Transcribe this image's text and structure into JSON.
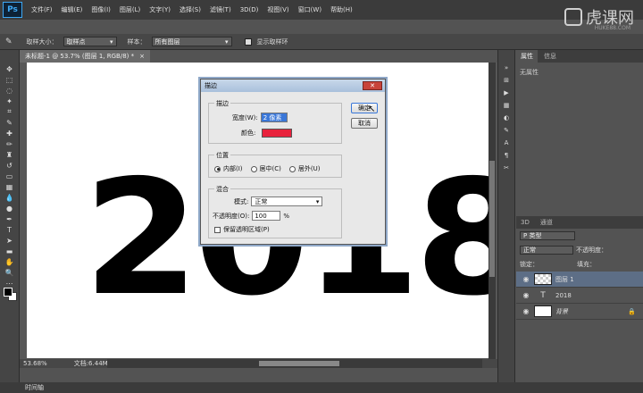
{
  "app": {
    "logo": "Ps"
  },
  "menu": [
    "文件(F)",
    "编辑(E)",
    "图像(I)",
    "图层(L)",
    "文字(Y)",
    "选择(S)",
    "滤镜(T)",
    "3D(D)",
    "视图(V)",
    "窗口(W)",
    "帮助(H)"
  ],
  "watermark": {
    "text": "虎课网",
    "url": "HUKE88.COM"
  },
  "options": {
    "sample_size_label": "取样大小：",
    "sample_size_value": "取样点",
    "sample_label": "样本：",
    "sample_value": "所有图层",
    "show_ring_label": "显示取样环"
  },
  "document": {
    "tab_title": "未标题-1 @ 53.7% (图层 1, RGB/8) *",
    "canvas_text": "2018"
  },
  "status": {
    "zoom": "53.68%",
    "doc_info": "文档:6.44M/1.88M"
  },
  "timeline": {
    "label": "时间轴"
  },
  "panels": {
    "tabs": [
      "属性",
      "信息"
    ],
    "props_text": "无属性",
    "layer_tabs": [
      "3D",
      "通道",
      "图层"
    ],
    "filter": "P 类型",
    "blend_mode": "正常",
    "opacity_label": "不透明度：",
    "lock_label": "锁定：",
    "fill_label": "填充：",
    "layers": [
      {
        "name": "图层 1",
        "type": "raster",
        "selected": true
      },
      {
        "name": "2018",
        "type": "text",
        "selected": false
      },
      {
        "name": "背景",
        "type": "background",
        "selected": false
      }
    ]
  },
  "dialog": {
    "title": "描边",
    "stroke_group": "描边",
    "width_label": "宽度(W):",
    "width_value": "2 像素",
    "color_label": "颜色:",
    "stroke_color": "#e8223c",
    "position_group": "位置",
    "positions": [
      "内部(I)",
      "居中(C)",
      "居外(U)"
    ],
    "selected_position": 0,
    "blend_group": "混合",
    "mode_label": "模式:",
    "mode_value": "正常",
    "opacity_label": "不透明度(O):",
    "opacity_value": "100",
    "opacity_unit": "%",
    "preserve_label": "保留透明区域(P)",
    "ok_label": "确定",
    "cancel_label": "取消"
  }
}
